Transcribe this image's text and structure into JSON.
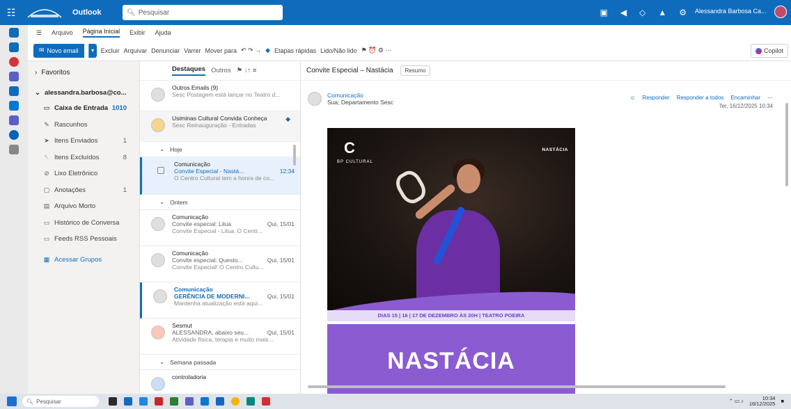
{
  "titlebar": {
    "app_name": "Outlook",
    "search_placeholder": "Pesquisar",
    "user_name": "Alessandra Barbosa Ca..."
  },
  "ribbon_tabs": [
    "Arquivo",
    "Página Inicial",
    "Exibir",
    "Ajuda"
  ],
  "ribbon": {
    "new_mail": "Novo email",
    "buttons": [
      "Excluir",
      "Arquivar",
      "Denunciar",
      "Varrer",
      "Mover para",
      "Etapas rápidas",
      "Lido/Não lido"
    ],
    "copilot": "Copilot"
  },
  "folders": {
    "favorites": "Favoritos",
    "account": "alessandra.barbosa@co...",
    "items": [
      {
        "label": "Caixa de Entrada",
        "count": "1010"
      },
      {
        "label": "Rascunhos",
        "count": ""
      },
      {
        "label": "Itens Enviados",
        "count": "1"
      },
      {
        "label": "Itens Excluídos",
        "count": "8"
      },
      {
        "label": "Lixo Eletrônico",
        "count": ""
      },
      {
        "label": "Anotações",
        "count": "1"
      },
      {
        "label": "Arquivo Morto",
        "count": ""
      },
      {
        "label": "Histórico de Conversa",
        "count": ""
      },
      {
        "label": "Feeds RSS Pessoais",
        "count": ""
      }
    ],
    "groups": "Acessar Grupos"
  },
  "list": {
    "tab_focused": "Destaques",
    "tab_other": "Outros",
    "items_top": [
      {
        "l1": "Outros Emails (9)",
        "l2": "",
        "l2r": "",
        "l3": "Sesc Postagem está lançar no Teatro d..."
      },
      {
        "l1": "Usiminas Cultural Convida Conheça",
        "l2": "Sesc Reinauguração - Entradas",
        "l2r": "",
        "l3": ""
      }
    ],
    "group_today": "Hoje",
    "item_today": {
      "l1": "Comunicação",
      "l2": "Convite Especial - Nastá...",
      "l2r": "12:34",
      "l3": "O Centro Cultural tem a honra de co..."
    },
    "group_week": "Ontem",
    "items_week": [
      {
        "l1": "Comunicação",
        "l2": "Convite especial: Lilua",
        "l2r": "Qui, 15/01",
        "l3": "Convite Especial - Lilua. O Centr..."
      },
      {
        "l1": "Comunicação",
        "l2": "Convite especial: Questo...",
        "l2r": "Qui, 15/01",
        "l3": "Convite Especial! O Centro Cultu..."
      },
      {
        "l1": "Comunicação",
        "l2": "GERÊNCIA DE MODERNI...",
        "l2r": "Qui, 15/01",
        "l3": "Mantenha atualização está aqui..."
      },
      {
        "l1": "Sesmut",
        "l2": "ALESSANDRA, abaixo seu...",
        "l2r": "Qui, 15/01",
        "l3": "Atividade física, terapia e muito mais..."
      }
    ],
    "group_last_week": "Semana passada",
    "item_last": {
      "l1": "controladoria",
      "l2": "",
      "l2r": "",
      "l3": ""
    }
  },
  "reading": {
    "subject": "Convite Especial – Nastácia",
    "summary_btn": "Resumo",
    "sender": "Comunicação",
    "to": "Sua; Departamento Sesc",
    "actions": [
      "Responder",
      "Responder a todos",
      "Encaminhar"
    ],
    "date": "Ter, 16/12/2025 10:34",
    "poster": {
      "left_logo": "C",
      "left_logo_text": "BP CULTURAL",
      "right_logo": "NASTÁCIA",
      "dates": "DIAS 15 | 16 | 17 DE DEZEMBRO ÀS 20H | TEATRO POEIRA",
      "title": "NASTÁCIA"
    }
  },
  "taskbar": {
    "search": "Pesquisar",
    "time": "10:34",
    "date": "16/12/2025"
  },
  "colors": {
    "accent": "#0f6cbd",
    "poster_purple": "#8a5bd1"
  }
}
